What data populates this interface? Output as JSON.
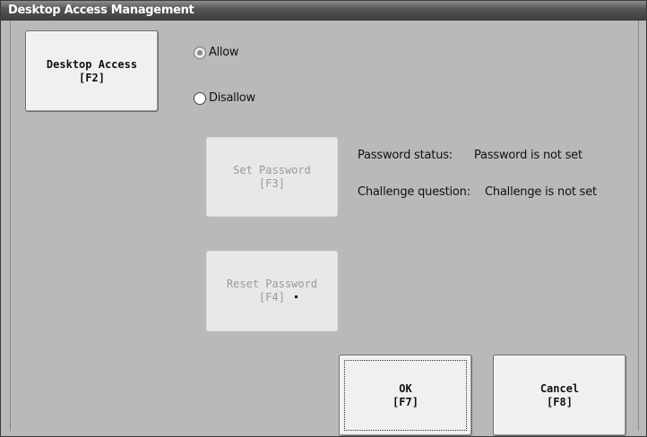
{
  "window": {
    "title": "Desktop Access Management"
  },
  "desktop_access_button": {
    "line1": "Desktop Access",
    "line2": "[F2]"
  },
  "access_options": [
    {
      "label": "Allow",
      "selected": true
    },
    {
      "label": "Disallow",
      "selected": false
    }
  ],
  "set_password_button": {
    "line1": "Set Password",
    "line2": "[F3]",
    "enabled": false
  },
  "reset_password_button": {
    "line1": "Reset Password",
    "line2": "[F4]",
    "enabled": false
  },
  "status": {
    "password_label": "Password status:",
    "password_value": "Password is not set",
    "challenge_label": "Challenge question:",
    "challenge_value": "Challenge is not set"
  },
  "ok_button": {
    "line1": "OK",
    "line2": "[F7]"
  },
  "cancel_button": {
    "line1": "Cancel",
    "line2": "[F8]"
  }
}
